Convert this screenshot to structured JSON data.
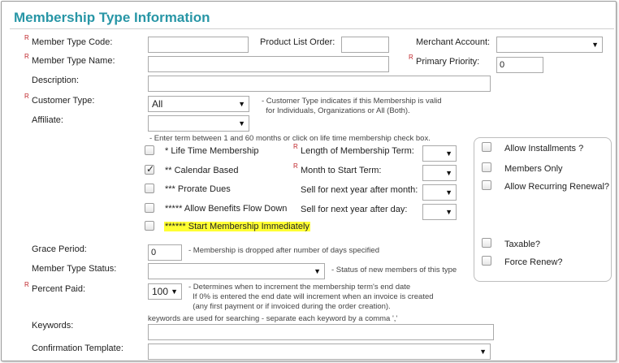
{
  "title": "Membership Type Information",
  "required_marker": "R",
  "fields": {
    "member_type_code": {
      "label": "Member Type Code:",
      "value": ""
    },
    "product_list_order": {
      "label": "Product List Order:",
      "value": ""
    },
    "merchant_account": {
      "label": "Merchant Account:",
      "value": ""
    },
    "member_type_name": {
      "label": "Member Type Name:",
      "value": ""
    },
    "primary_priority": {
      "label": "Primary Priority:",
      "value": "0"
    },
    "description": {
      "label": "Description:",
      "value": ""
    },
    "customer_type": {
      "label": "Customer Type:",
      "value": "All",
      "note": "- Customer Type indicates if this Membership is valid\n  for Individuals, Organizations or All (Both)."
    },
    "affiliate": {
      "label": "Affiliate:",
      "value": ""
    },
    "grace_period": {
      "label": "Grace Period:",
      "value": "0",
      "note": "- Membership is dropped after number of days specified"
    },
    "member_type_status": {
      "label": "Member Type Status:",
      "value": "",
      "note": "- Status of new members of this type"
    },
    "percent_paid": {
      "label": "Percent Paid:",
      "value": "100",
      "note": "- Determines when to increment the membership term's end date\n  If 0% is entered the end date will increment when an invoice is created\n  (any first payment or if invoiced during the order creation)."
    },
    "keywords": {
      "label": "Keywords:",
      "value": "",
      "note": "keywords are used for searching - separate each keyword by a comma ','"
    },
    "confirmation_template": {
      "label": "Confirmation Template:",
      "value": ""
    }
  },
  "term_note": "- Enter term between 1 and 60 months or click on life time membership check box.",
  "term_options": {
    "lifetime": {
      "label": "* Life Time Membership",
      "checked": false
    },
    "calendar": {
      "label": "** Calendar Based",
      "checked": true
    },
    "prorate": {
      "label": "*** Prorate Dues",
      "checked": false
    },
    "benefits_flow": {
      "label": "***** Allow Benefits Flow Down",
      "checked": false
    },
    "start_immediately": {
      "label": "****** Start Membership Immediately",
      "checked": false
    }
  },
  "term_fields": {
    "length": {
      "label": "Length of Membership Term:",
      "value": ""
    },
    "month_start": {
      "label": "Month to Start Term:",
      "value": ""
    },
    "sell_month": {
      "label": "Sell for next year after month:",
      "value": ""
    },
    "sell_day": {
      "label": "Sell for next year after day:",
      "value": ""
    }
  },
  "side_options": {
    "installments": {
      "label": "Allow Installments ?",
      "checked": false
    },
    "members_only": {
      "label": "Members Only",
      "checked": false
    },
    "recurring": {
      "label": "Allow Recurring Renewal?",
      "checked": false
    },
    "taxable": {
      "label": "Taxable?",
      "checked": false
    },
    "force_renew": {
      "label": "Force Renew?",
      "checked": false
    }
  },
  "colors": {
    "title": "#2896a6",
    "required": "#c0282d",
    "highlight": "#ffff33"
  },
  "icons": {
    "dropdown": "triangle-down",
    "check": "check-mark"
  }
}
